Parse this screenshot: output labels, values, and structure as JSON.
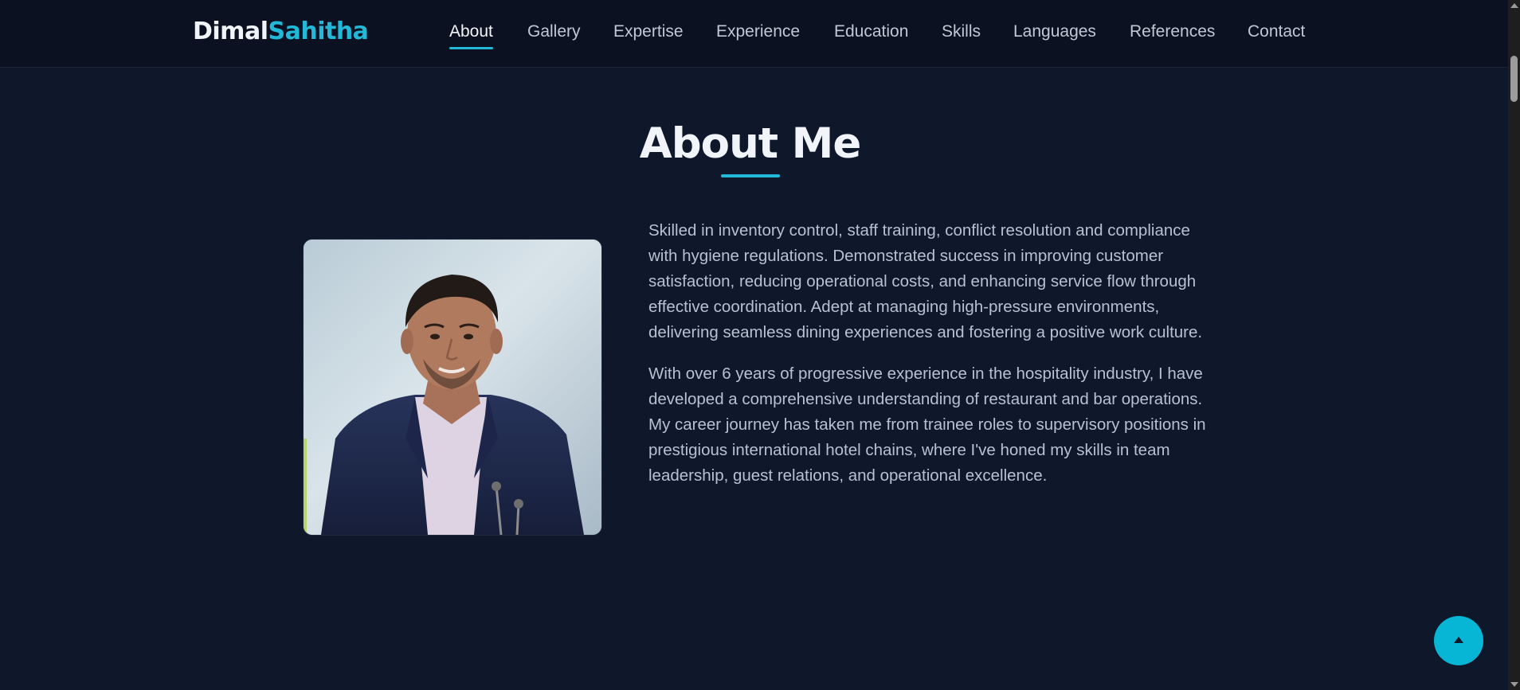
{
  "brand": {
    "first": "Dimal",
    "last": "Sahitha"
  },
  "nav": {
    "items": [
      {
        "label": "About",
        "active": true
      },
      {
        "label": "Gallery",
        "active": false
      },
      {
        "label": "Expertise",
        "active": false
      },
      {
        "label": "Experience",
        "active": false
      },
      {
        "label": "Education",
        "active": false
      },
      {
        "label": "Skills",
        "active": false
      },
      {
        "label": "Languages",
        "active": false
      },
      {
        "label": "References",
        "active": false
      },
      {
        "label": "Contact",
        "active": false
      }
    ]
  },
  "about": {
    "title": "About Me",
    "paragraphs": [
      "Skilled in inventory control, staff training, conflict resolution and compliance with hygiene regulations. Demonstrated success in improving customer satisfaction, reducing operational costs, and enhancing service flow through effective coordination. Adept at managing high-pressure environments, delivering seamless dining experiences and fostering a positive work culture.",
      "With over 6 years of progressive experience in the hospitality industry, I have developed a comprehensive understanding of restaurant and bar operations. My career journey has taken me from trainee roles to supervisory positions in prestigious international hotel chains, where I've honed my skills in team leadership, guest relations, and operational excellence."
    ]
  },
  "back_to_top": {
    "icon": "chevron-up-icon"
  },
  "colors": {
    "background": "#0f172a",
    "header": "#0b1120",
    "accent": "#22b8d8",
    "text": "#b7c1cf",
    "heading": "#f1f5f9"
  }
}
